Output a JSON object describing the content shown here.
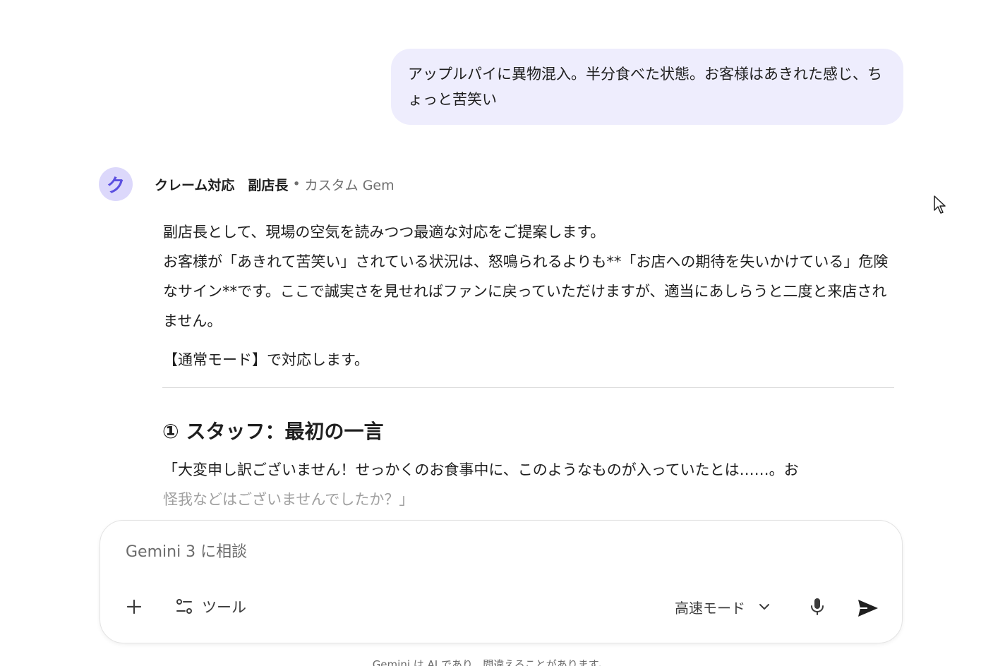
{
  "user_message": {
    "text": "アップルパイに異物混入。半分食べた状態。お客様はあきれた感じ、ちょっと苦笑い"
  },
  "gem": {
    "avatar_letter": "ク",
    "name": "クレーム対応　副店長",
    "separator": "•",
    "type": "カスタム Gem"
  },
  "response": {
    "paragraph_1_line_1": "副店長として、現場の空気を読みつつ最適な対応をご提案します。",
    "paragraph_1_rest": "お客様が「あきれて苦笑い」されている状況は、怒鳴られるよりも**「お店への期待を失いかけている」危険なサイン**です。ここで誠実さを見せればファンに戻っていただけますが、適当にあしらうと二度と来店されません。",
    "mode_line": "【通常モード】で対応します。",
    "section_1_heading": "① スタッフ：最初の一言",
    "section_1_body_line_1": "「大変申し訳ございません！せっかくのお食事中に、このようなものが入っていたとは……。お",
    "section_1_body_line_2": "怪我などはございませんでしたか？」"
  },
  "composer": {
    "placeholder": "Gemini 3 に相談",
    "value": "",
    "tools_label": "ツール",
    "mode_label": "高速モード"
  },
  "disclaimer": "Gemini は AI であり、間違えることがあります。",
  "colors": {
    "user_bubble_bg": "#eeedfd",
    "avatar_bg": "#dcd8fb",
    "avatar_fg": "#5b4fe0"
  },
  "icons": {
    "plus": "plus-icon",
    "tools": "tune-icon",
    "chevron": "chevron-down-icon",
    "mic": "microphone-icon",
    "send": "send-icon",
    "cursor": "mouse-pointer-icon"
  }
}
